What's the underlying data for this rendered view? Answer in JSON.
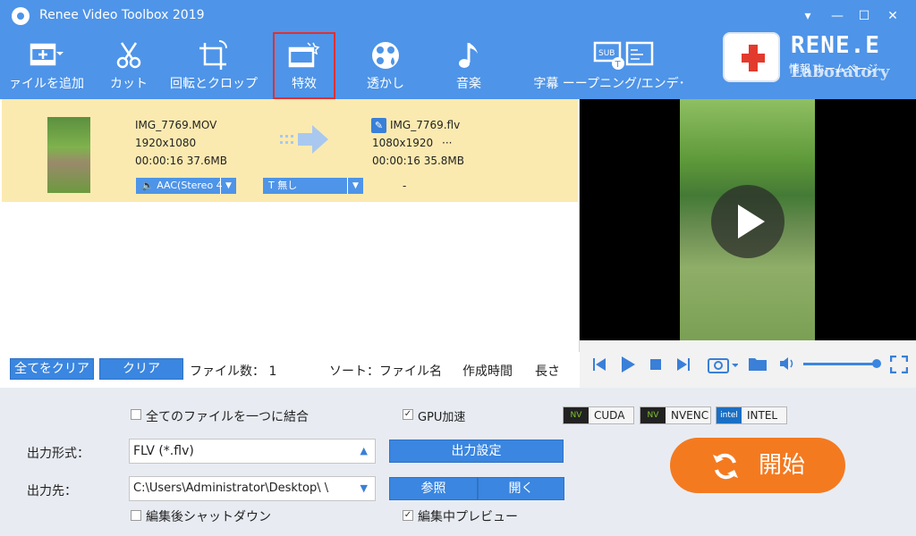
{
  "app": {
    "title": "Renee Video Toolbox 2019"
  },
  "window_controls": {
    "dropdown": "▾",
    "minimize": "—",
    "maximize": "☐",
    "close": "✕"
  },
  "toolbar": {
    "items": [
      {
        "label": "ァイルを追加",
        "icon": "add-file-icon"
      },
      {
        "label": "カット",
        "icon": "scissors-icon"
      },
      {
        "label": "回転とクロップ",
        "icon": "crop-rotate-icon"
      },
      {
        "label": "特效",
        "icon": "effects-icon"
      },
      {
        "label": "透かし",
        "icon": "watermark-icon"
      },
      {
        "label": "音楽",
        "icon": "music-icon"
      },
      {
        "label": "字幕 ーープニング/エンデ･",
        "icon": "subtitle-icon"
      }
    ]
  },
  "brand": {
    "name": "RENE.E",
    "sub": "Laboratory",
    "links": "情報 ホームページ"
  },
  "file": {
    "source_name": "IMG_7769.MOV",
    "source_res": "1920x1080",
    "source_meta": "00:00:16  37.6MB",
    "output_name": "IMG_7769.flv",
    "output_res": "1080x1920",
    "output_more": "···",
    "output_meta": "00:00:16  35.8MB",
    "audio": "AAC(Stereo 4",
    "subtitle": "無し",
    "dash": "-"
  },
  "list_footer": {
    "clear_all": "全てをクリア",
    "clear": "クリア",
    "file_count": "ファイル数：  1",
    "sort": "ソート：ファイル名",
    "created": "作成時間",
    "length": "長さ"
  },
  "settings": {
    "merge_label": "全てのファイルを一つに結合",
    "gpu_label": "GPU加速",
    "gpu_badges": [
      "CUDA",
      "NVENC",
      "INTEL"
    ],
    "format_label": "出力形式：",
    "format_value": "FLV (*.flv)",
    "output_settings": "出力設定",
    "dest_label": "出力先：",
    "dest_value": "C:\\Users\\Administrator\\Desktop\\    \\",
    "browse": "参照",
    "open": "開く",
    "shutdown_label": "編集後シャットダウン",
    "preview_label": "編集中プレビュー",
    "start": "開始"
  },
  "colors": {
    "accent": "#4e94e8",
    "row_highlight": "#fbeab0",
    "start": "#f47a20",
    "highlight_border": "#e03030"
  }
}
